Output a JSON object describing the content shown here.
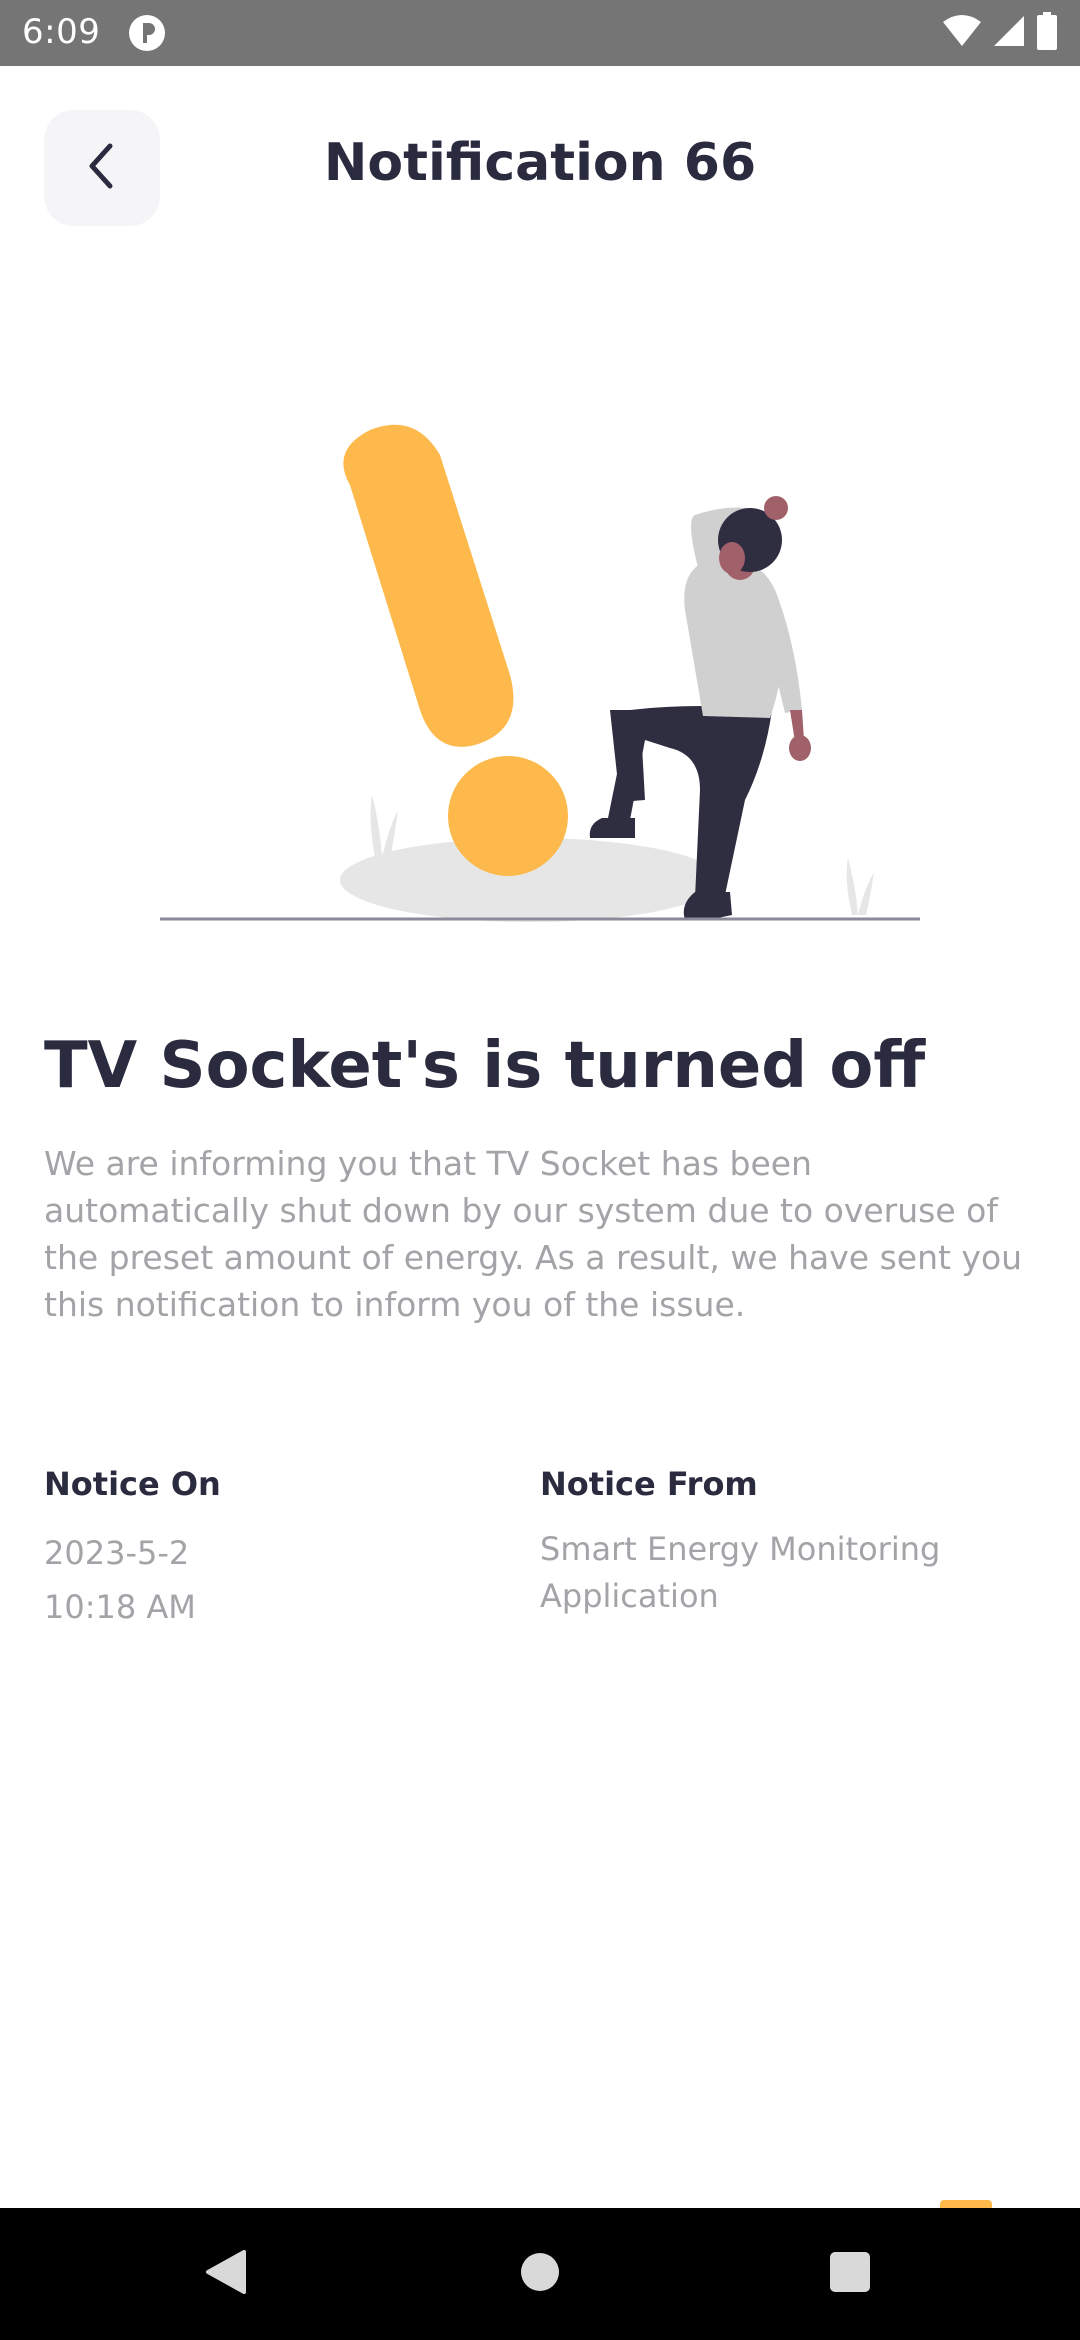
{
  "status_bar": {
    "time": "6:09",
    "icons": [
      "app-notification-icon",
      "wifi-icon",
      "cell-signal-icon",
      "battery-icon"
    ]
  },
  "header": {
    "title": "Notification 66",
    "back_icon": "chevron-left-icon"
  },
  "illustration": {
    "description_icon": "warning-exclamation-illustration",
    "colors": {
      "accent": "#fdb94c",
      "ground": "#e6e6e6",
      "ink": "#2f2e41",
      "shirt": "#cbcbcb",
      "skin": "#a0616a",
      "line": "#8a8a99"
    }
  },
  "notification": {
    "headline": "TV Socket's is turned off",
    "message": "We are informing you that TV Socket has been automatically shut down by our system due to overuse of the preset amount of energy. As a result, we have sent you this notification to inform you of the issue."
  },
  "details": {
    "notice_on_label": "Notice On",
    "notice_on_date": "2023-5-2",
    "notice_on_time": "10:18 AM",
    "notice_from_label": "Notice From",
    "notice_from_value": "Smart Energy Monitoring Application"
  },
  "nav_bar": {
    "buttons": [
      "back-triangle-icon",
      "home-circle-icon",
      "recents-square-icon"
    ]
  },
  "colors": {
    "title_text": "#2a2b3f",
    "body_text": "#a3a3a8",
    "back_button_bg": "#f5f5f7",
    "status_bar_bg": "#757575"
  }
}
